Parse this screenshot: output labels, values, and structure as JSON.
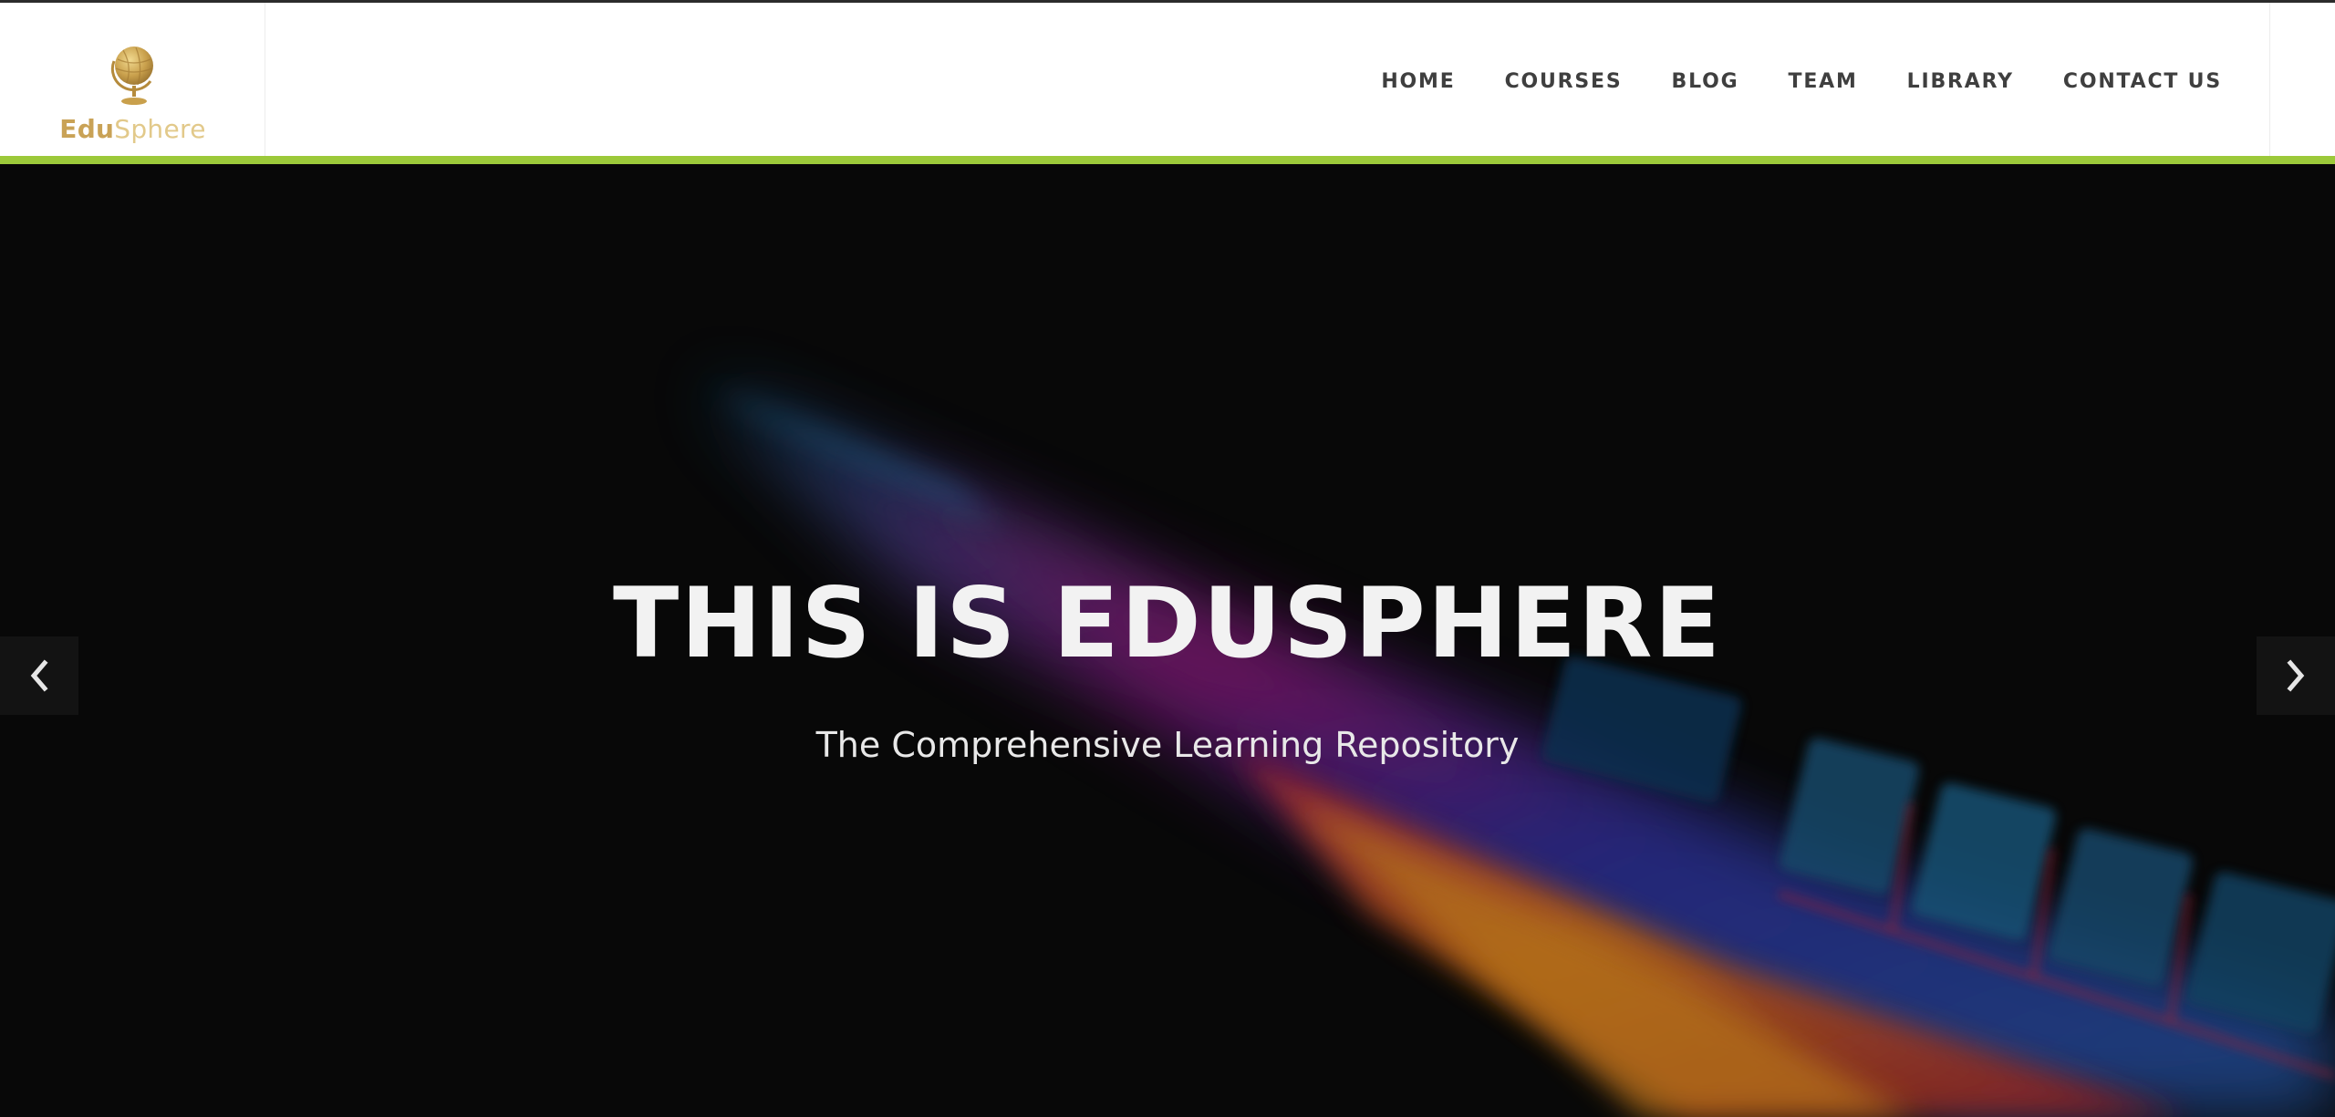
{
  "brand": {
    "name_part1": "Edu",
    "name_part2": "Sphere",
    "logo_icon": "globe-icon",
    "colors": {
      "gold": "#c9a256",
      "gold_light": "#e2c98a"
    }
  },
  "nav": {
    "items": [
      {
        "label": "HOME"
      },
      {
        "label": "COURSES"
      },
      {
        "label": "BLOG"
      },
      {
        "label": "TEAM"
      },
      {
        "label": "LIBRARY"
      },
      {
        "label": "CONTACT US"
      }
    ]
  },
  "hero": {
    "title": "THIS IS EDUSPHERE",
    "subtitle": "The Comprehensive Learning Repository",
    "prev_icon": "chevron-left-icon",
    "next_icon": "chevron-right-icon"
  },
  "colors": {
    "accent": "#9cc93a",
    "header_bg": "#ffffff",
    "hero_bg": "#080808",
    "nav_text": "#3f3f3f"
  }
}
